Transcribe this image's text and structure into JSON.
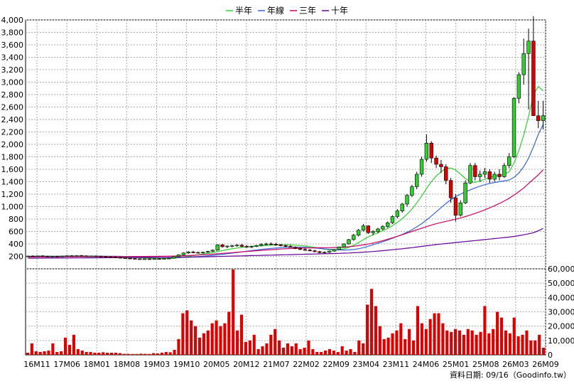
{
  "chart_data": [
    {
      "type": "candlestick",
      "legend": [
        {
          "name": "半年",
          "color": "#33cc33"
        },
        {
          "name": "年線",
          "color": "#3366cc"
        },
        {
          "name": "三年",
          "color": "#cc0066"
        },
        {
          "name": "十年",
          "color": "#660099"
        }
      ],
      "ylim": [
        0,
        4000
      ],
      "y_ticks": [
        200,
        400,
        600,
        800,
        1000,
        1200,
        1400,
        1600,
        1800,
        2000,
        2200,
        2400,
        2600,
        2800,
        3000,
        3200,
        3400,
        3600,
        3800,
        4000
      ],
      "y_tick_labels": [
        "200",
        "400",
        "600",
        "800",
        "1,000",
        "1,200",
        "1,400",
        "1,600",
        "1,800",
        "2,000",
        "2,200",
        "2,400",
        "2,600",
        "2,800",
        "3,000",
        "3,200",
        "3,400",
        "3,600",
        "3,800",
        "4,000"
      ],
      "grid": true,
      "up_color": "#33cc33",
      "down_color": "#dd0000",
      "ohlc": [
        [
          200,
          210,
          190,
          205
        ],
        [
          205,
          215,
          195,
          200
        ],
        [
          200,
          212,
          190,
          208
        ],
        [
          208,
          218,
          196,
          200
        ],
        [
          200,
          210,
          188,
          195
        ],
        [
          195,
          205,
          182,
          200
        ],
        [
          200,
          210,
          190,
          198
        ],
        [
          198,
          208,
          188,
          205
        ],
        [
          205,
          214,
          195,
          210
        ],
        [
          210,
          220,
          200,
          205
        ],
        [
          205,
          215,
          195,
          212
        ],
        [
          212,
          222,
          200,
          208
        ],
        [
          208,
          216,
          198,
          202
        ],
        [
          202,
          212,
          192,
          205
        ],
        [
          205,
          214,
          195,
          200
        ],
        [
          200,
          210,
          190,
          196
        ],
        [
          196,
          206,
          186,
          192
        ],
        [
          192,
          200,
          182,
          186
        ],
        [
          186,
          196,
          176,
          182
        ],
        [
          182,
          190,
          170,
          176
        ],
        [
          176,
          184,
          165,
          170
        ],
        [
          170,
          178,
          160,
          165
        ],
        [
          165,
          172,
          156,
          160
        ],
        [
          160,
          168,
          152,
          156
        ],
        [
          156,
          164,
          148,
          160
        ],
        [
          160,
          168,
          150,
          158
        ],
        [
          158,
          166,
          150,
          162
        ],
        [
          162,
          170,
          152,
          160
        ],
        [
          160,
          168,
          150,
          165
        ],
        [
          165,
          175,
          155,
          170
        ],
        [
          170,
          200,
          165,
          195
        ],
        [
          195,
          235,
          188,
          225
        ],
        [
          225,
          265,
          215,
          255
        ],
        [
          255,
          285,
          240,
          270
        ],
        [
          270,
          290,
          250,
          262
        ],
        [
          262,
          278,
          248,
          258
        ],
        [
          258,
          275,
          245,
          265
        ],
        [
          265,
          290,
          255,
          280
        ],
        [
          280,
          310,
          270,
          300
        ],
        [
          300,
          395,
          290,
          385
        ],
        [
          385,
          400,
          340,
          355
        ],
        [
          355,
          375,
          330,
          365
        ],
        [
          365,
          385,
          345,
          372
        ],
        [
          372,
          395,
          355,
          380
        ],
        [
          380,
          400,
          350,
          360
        ],
        [
          360,
          380,
          340,
          350
        ],
        [
          350,
          375,
          330,
          362
        ],
        [
          362,
          385,
          350,
          375
        ],
        [
          375,
          410,
          360,
          395
        ],
        [
          395,
          420,
          375,
          400
        ],
        [
          400,
          425,
          380,
          395
        ],
        [
          395,
          415,
          370,
          385
        ],
        [
          385,
          400,
          360,
          372
        ],
        [
          372,
          390,
          350,
          360
        ],
        [
          360,
          380,
          340,
          345
        ],
        [
          345,
          360,
          315,
          325
        ],
        [
          325,
          345,
          300,
          310
        ],
        [
          310,
          330,
          290,
          300
        ],
        [
          300,
          320,
          280,
          290
        ],
        [
          290,
          305,
          265,
          275
        ],
        [
          275,
          290,
          250,
          260
        ],
        [
          260,
          280,
          245,
          265
        ],
        [
          265,
          290,
          255,
          285
        ],
        [
          285,
          320,
          275,
          310
        ],
        [
          310,
          360,
          300,
          350
        ],
        [
          350,
          410,
          340,
          400
        ],
        [
          400,
          480,
          390,
          470
        ],
        [
          470,
          560,
          450,
          540
        ],
        [
          540,
          640,
          520,
          620
        ],
        [
          620,
          720,
          600,
          690
        ],
        [
          690,
          700,
          560,
          580
        ],
        [
          580,
          620,
          540,
          600
        ],
        [
          600,
          660,
          570,
          640
        ],
        [
          640,
          700,
          620,
          680
        ],
        [
          680,
          760,
          660,
          740
        ],
        [
          740,
          860,
          720,
          840
        ],
        [
          840,
          960,
          810,
          930
        ],
        [
          930,
          1060,
          900,
          1040
        ],
        [
          1040,
          1200,
          1000,
          1180
        ],
        [
          1180,
          1350,
          1150,
          1320
        ],
        [
          1320,
          1560,
          1280,
          1520
        ],
        [
          1520,
          1800,
          1480,
          1760
        ],
        [
          1760,
          2160,
          1720,
          2020
        ],
        [
          2020,
          2050,
          1700,
          1780
        ],
        [
          1780,
          1820,
          1620,
          1680
        ],
        [
          1680,
          1750,
          1540,
          1640
        ],
        [
          1640,
          1680,
          1360,
          1420
        ],
        [
          1420,
          1460,
          1060,
          1140
        ],
        [
          1140,
          1200,
          760,
          860
        ],
        [
          860,
          1100,
          840,
          1060
        ],
        [
          1060,
          1420,
          1040,
          1380
        ],
        [
          1380,
          1700,
          1360,
          1660
        ],
        [
          1660,
          1700,
          1420,
          1480
        ],
        [
          1480,
          1580,
          1400,
          1520
        ],
        [
          1520,
          1620,
          1460,
          1560
        ],
        [
          1560,
          1600,
          1380,
          1440
        ],
        [
          1440,
          1560,
          1400,
          1520
        ],
        [
          1520,
          1600,
          1420,
          1480
        ],
        [
          1480,
          1700,
          1460,
          1660
        ],
        [
          1660,
          1860,
          1620,
          1800
        ],
        [
          1800,
          2760,
          1780,
          2740
        ],
        [
          2740,
          3160,
          2660,
          3120
        ],
        [
          3120,
          3700,
          2960,
          3460
        ],
        [
          3460,
          3860,
          2560,
          3660
        ],
        [
          3660,
          4060,
          2600,
          2460
        ],
        [
          2460,
          2700,
          2260,
          2380
        ],
        [
          2380,
          2700,
          2240,
          2460
        ]
      ],
      "ma": {
        "半年": [
          200,
          201,
          202,
          203,
          203,
          202,
          201,
          200,
          201,
          202,
          204,
          205,
          205,
          204,
          203,
          202,
          200,
          198,
          195,
          192,
          188,
          184,
          180,
          176,
          172,
          170,
          168,
          166,
          165,
          166,
          170,
          178,
          188,
          200,
          212,
          224,
          236,
          248,
          260,
          275,
          292,
          308,
          322,
          334,
          344,
          352,
          358,
          364,
          370,
          376,
          380,
          384,
          386,
          386,
          384,
          380,
          374,
          366,
          356,
          344,
          330,
          316,
          306,
          302,
          306,
          320,
          344,
          378,
          420,
          468,
          512,
          548,
          580,
          612,
          648,
          692,
          744,
          806,
          878,
          960,
          1060,
          1170,
          1290,
          1400,
          1490,
          1560,
          1610,
          1620,
          1590,
          1520,
          1450,
          1400,
          1390,
          1410,
          1440,
          1470,
          1490,
          1500,
          1520,
          1560,
          1700,
          1900,
          2150,
          2450,
          2800,
          2930,
          2860
        ],
        "年線": [
          200,
          200,
          201,
          201,
          202,
          202,
          202,
          202,
          202,
          202,
          203,
          203,
          203,
          203,
          203,
          203,
          202,
          202,
          201,
          200,
          198,
          196,
          194,
          192,
          190,
          188,
          186,
          184,
          182,
          181,
          181,
          182,
          184,
          187,
          191,
          196,
          202,
          209,
          216,
          224,
          233,
          242,
          252,
          262,
          272,
          282,
          292,
          302,
          312,
          320,
          328,
          334,
          340,
          344,
          346,
          347,
          346,
          344,
          340,
          334,
          328,
          320,
          314,
          308,
          304,
          302,
          304,
          310,
          322,
          340,
          362,
          386,
          410,
          436,
          462,
          490,
          520,
          552,
          588,
          628,
          674,
          726,
          784,
          848,
          916,
          984,
          1050,
          1110,
          1160,
          1200,
          1236,
          1270,
          1300,
          1328,
          1352,
          1372,
          1388,
          1400,
          1412,
          1428,
          1470,
          1540,
          1640,
          1780,
          1960,
          2160,
          2320
        ],
        "三年": [
          190,
          190,
          191,
          191,
          192,
          192,
          193,
          193,
          194,
          194,
          195,
          195,
          196,
          196,
          196,
          197,
          197,
          197,
          198,
          198,
          198,
          198,
          199,
          199,
          199,
          200,
          200,
          201,
          202,
          203,
          205,
          207,
          210,
          213,
          217,
          221,
          226,
          231,
          236,
          242,
          248,
          254,
          260,
          266,
          272,
          278,
          284,
          290,
          296,
          302,
          308,
          313,
          318,
          322,
          326,
          330,
          332,
          334,
          336,
          337,
          338,
          339,
          340,
          342,
          344,
          348,
          354,
          362,
          372,
          384,
          398,
          414,
          432,
          452,
          474,
          498,
          522,
          548,
          574,
          600,
          626,
          652,
          678,
          702,
          724,
          744,
          762,
          780,
          798,
          818,
          840,
          864,
          890,
          918,
          948,
          980,
          1014,
          1050,
          1090,
          1134,
          1184,
          1240,
          1300,
          1370,
          1440,
          1510,
          1590
        ],
        "十年": [
          170,
          170,
          171,
          171,
          172,
          172,
          173,
          173,
          174,
          174,
          175,
          175,
          176,
          176,
          177,
          177,
          178,
          178,
          179,
          179,
          180,
          180,
          181,
          181,
          182,
          182,
          183,
          183,
          184,
          184,
          185,
          186,
          187,
          188,
          189,
          190,
          192,
          194,
          196,
          198,
          200,
          202,
          204,
          206,
          208,
          210,
          212,
          214,
          216,
          218,
          220,
          222,
          224,
          226,
          228,
          230,
          232,
          234,
          236,
          238,
          240,
          242,
          244,
          246,
          248,
          251,
          254,
          258,
          262,
          267,
          272,
          278,
          284,
          291,
          298,
          306,
          314,
          322,
          331,
          340,
          350,
          360,
          370,
          380,
          390,
          398,
          406,
          414,
          422,
          430,
          438,
          446,
          454,
          462,
          470,
          478,
          486,
          494,
          502,
          510,
          520,
          532,
          546,
          562,
          580,
          610,
          650
        ]
      },
      "x_tick_labels": [
        "16M11",
        "17M06",
        "18M01",
        "18M08",
        "19M03",
        "19M10",
        "20M05",
        "20M12",
        "21M07",
        "22M02",
        "22M09",
        "23M04",
        "23M11",
        "24M06",
        "25M01",
        "25M08",
        "26M03",
        "26M09"
      ]
    },
    {
      "type": "bar",
      "ylim": [
        0,
        60000
      ],
      "y_tick_labels": [
        "0",
        "10,000",
        "20,000",
        "30,000",
        "40,000",
        "50,000",
        "60,000"
      ],
      "color": "#dd0000",
      "values": [
        1500,
        8000,
        2500,
        2000,
        2500,
        3000,
        8000,
        2000,
        2500,
        12000,
        7000,
        14000,
        4000,
        3000,
        2000,
        2000,
        1500,
        1500,
        1800,
        1500,
        1500,
        1500,
        1200,
        700,
        700,
        600,
        600,
        800,
        700,
        600,
        1200,
        1000,
        1500,
        2000,
        1800,
        3500,
        11000,
        29000,
        31000,
        24000,
        20000,
        12000,
        15000,
        17000,
        22000,
        24000,
        20000,
        22000,
        30000,
        67000,
        17000,
        28000,
        9000,
        10000,
        14000,
        4000,
        6000,
        8000,
        14000,
        18000,
        10000,
        5000,
        8000,
        6000,
        8000,
        4000,
        5000,
        10000,
        4000,
        2000,
        2000,
        3000,
        4000,
        3000,
        2000,
        6000,
        3000,
        4000,
        2000,
        10000,
        8000,
        35000,
        46000,
        34000,
        20000,
        11000,
        12000,
        15000,
        17000,
        22000,
        11000,
        18000,
        10000,
        34000,
        22000,
        18000,
        25000,
        29000,
        29000,
        22000,
        17000,
        16000,
        18000,
        17000,
        14000,
        18000,
        17000,
        14000,
        16000,
        34000,
        15000,
        18000,
        30000,
        26000,
        17000,
        15000,
        26000,
        13000,
        14000,
        17000,
        10000,
        10000,
        14000,
        5000
      ]
    }
  ],
  "source_label": "資料日期: 09/16（Goodinfo.tw）"
}
